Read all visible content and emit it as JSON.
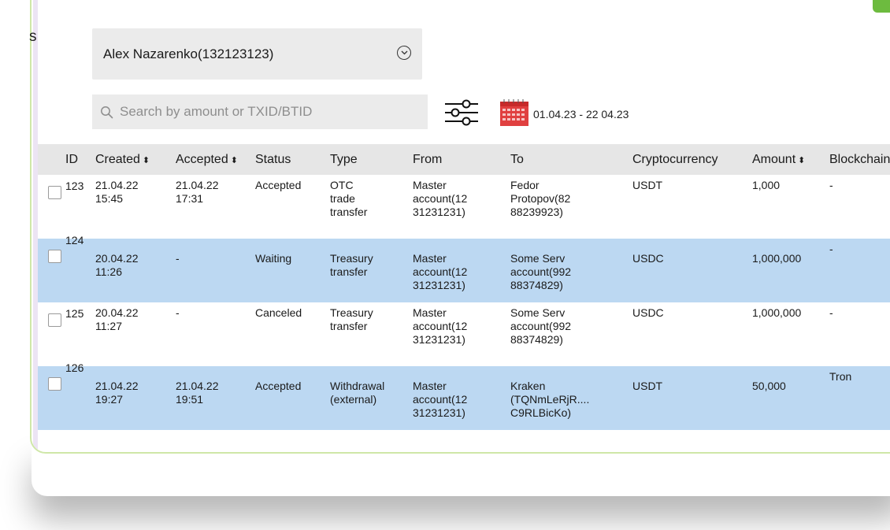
{
  "side_letter": "s",
  "account": {
    "selected": "Alex Nazarenko(132123123)"
  },
  "search": {
    "placeholder": "Search by amount or TXID/BTID"
  },
  "date_range": "01.04.23 - 22 04.23",
  "icons": {
    "chevron": "chevron-down-circle-icon",
    "search": "search-icon",
    "filter": "sliders-filter-icon",
    "calendar": "calendar-icon"
  },
  "colors": {
    "highlight_row": "#bcd8f2",
    "header_bg": "#e6e6e6",
    "accent_green": "#6dbb3f",
    "window_border": "#cfe7a8"
  },
  "table": {
    "headers": {
      "id": "ID",
      "created": "Created",
      "accepted": "Accepted",
      "status": "Status",
      "type": "Type",
      "from": "From",
      "to": "To",
      "crypto": "Cryptocurrency",
      "amount": "Amount",
      "blockchain": "Blockchain"
    },
    "sort_glyph": "⬍",
    "rows": [
      {
        "id": "123",
        "created": [
          "21.04.22",
          "15:45"
        ],
        "accepted": [
          "21.04.22",
          "17:31"
        ],
        "status": "Accepted",
        "type": [
          "OTC",
          "trade",
          "transfer"
        ],
        "from": [
          "Master",
          "account(12",
          "31231231)"
        ],
        "to": [
          "Fedor",
          "Protopov(82",
          "88239923)"
        ],
        "crypto": "USDT",
        "amount": "1,000",
        "blockchain": "-"
      },
      {
        "id": "124",
        "created": [
          "20.04.22",
          "11:26"
        ],
        "accepted": [
          "-"
        ],
        "status": "Waiting",
        "type": [
          "Treasury",
          "transfer"
        ],
        "from": [
          "Master",
          "account(12",
          "31231231)"
        ],
        "to": [
          "Some Serv",
          "account(992",
          "88374829)"
        ],
        "crypto": "USDC",
        "amount": "1,000,000",
        "blockchain": "-"
      },
      {
        "id": "125",
        "created": [
          "20.04.22",
          "11:27"
        ],
        "accepted": [
          "-"
        ],
        "status": "Canceled",
        "type": [
          "Treasury",
          "transfer"
        ],
        "from": [
          "Master",
          "account(12",
          "31231231)"
        ],
        "to": [
          "Some Serv",
          "account(992",
          "88374829)"
        ],
        "crypto": "USDC",
        "amount": "1,000,000",
        "blockchain": "-"
      },
      {
        "id": "126",
        "created": [
          "21.04.22",
          "19:27"
        ],
        "accepted": [
          "21.04.22",
          "19:51"
        ],
        "status": "Accepted",
        "type": [
          "Withdrawal",
          "(external)"
        ],
        "from": [
          "Master",
          "account(12",
          "31231231)"
        ],
        "to": [
          "Kraken",
          "(TQNmLeRjR....",
          "C9RLBicKo)"
        ],
        "crypto": "USDT",
        "amount": "50,000",
        "blockchain": "Tron"
      }
    ]
  }
}
